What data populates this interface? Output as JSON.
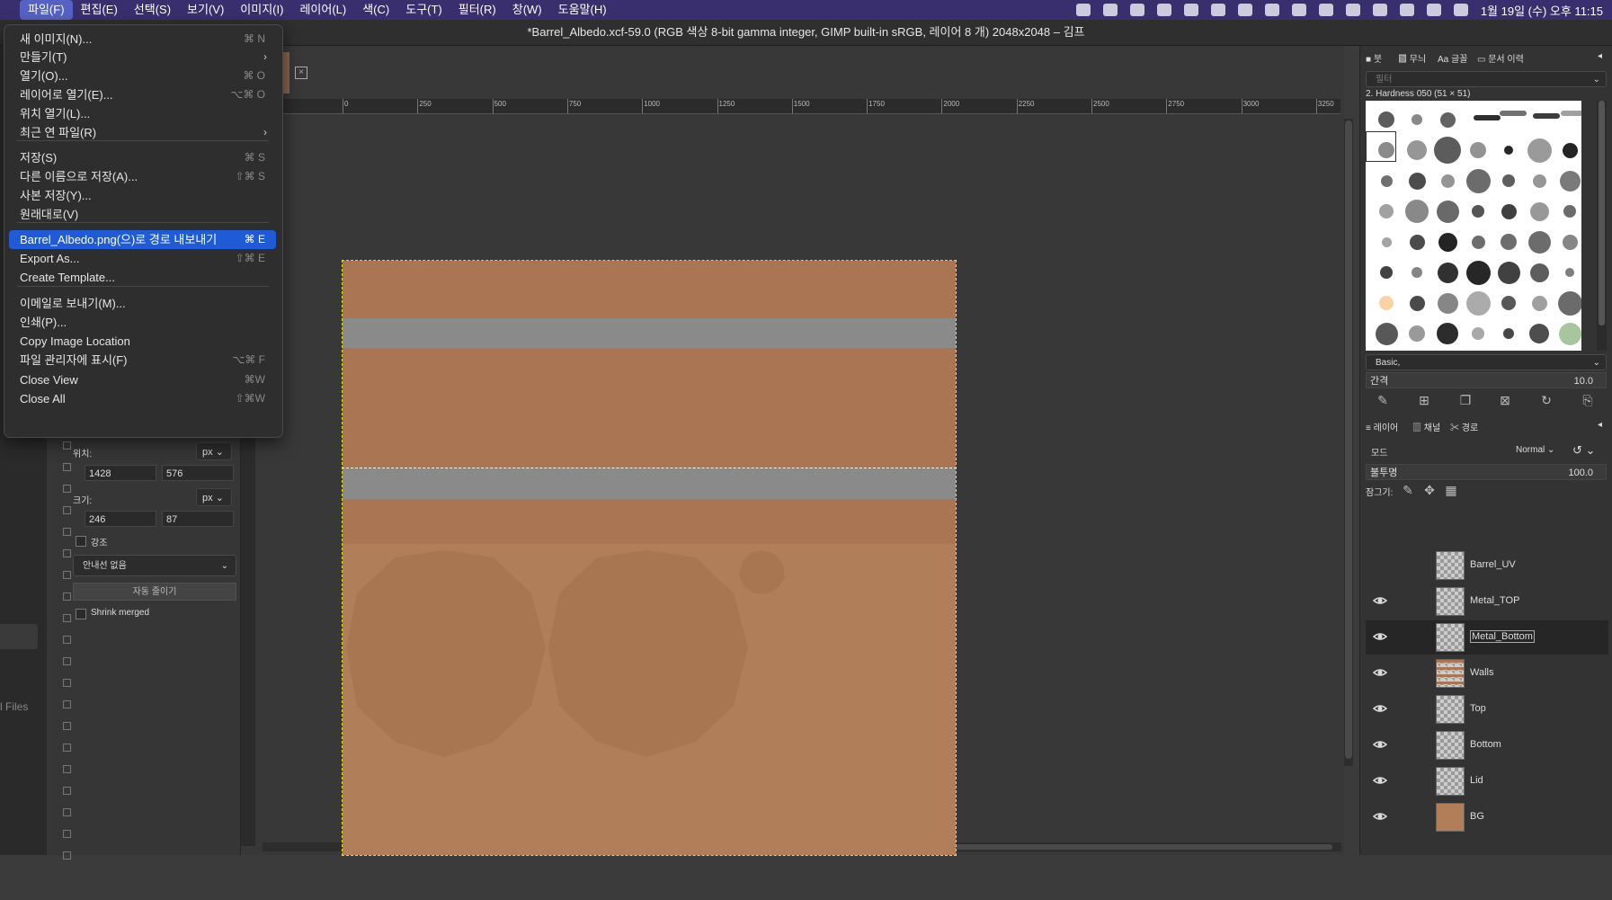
{
  "menubar": {
    "items": [
      "파일(F)",
      "편집(E)",
      "선택(S)",
      "보기(V)",
      "이미지(I)",
      "레이어(L)",
      "색(C)",
      "도구(T)",
      "필터(R)",
      "창(W)",
      "도움말(H)"
    ],
    "clock": "1월 19일 (수) 오후 11:15"
  },
  "window": {
    "title": "*Barrel_Albedo.xcf-59.0 (RGB 색상 8-bit gamma integer, GIMP built-in sRGB, 레이어 8 개) 2048x2048 – 김프"
  },
  "file_menu": {
    "items": [
      {
        "label": "새 이미지(N)...",
        "shortcut": "⌘ N"
      },
      {
        "label": "만들기(T)",
        "submenu": true
      },
      {
        "label": "열기(O)...",
        "shortcut": "⌘ O"
      },
      {
        "label": "레이어로 열기(E)...",
        "shortcut": "⌥⌘ O"
      },
      {
        "label": "위치 열기(L)...",
        "shortcut": ""
      },
      {
        "label": "최근 연 파일(R)",
        "submenu": true
      },
      {
        "label": "저장(S)",
        "shortcut": "⌘ S"
      },
      {
        "label": "다른 이름으로 저장(A)...",
        "shortcut": "⇧⌘ S"
      },
      {
        "label": "사본 저장(Y)...",
        "shortcut": ""
      },
      {
        "label": "원래대로(V)",
        "shortcut": ""
      },
      {
        "label": "Barrel_Albedo.png(으)로 경로 내보내기",
        "shortcut": "⌘ E",
        "highlighted": true
      },
      {
        "label": "Export As...",
        "shortcut": "⇧⌘ E"
      },
      {
        "label": "Create Template...",
        "shortcut": ""
      },
      {
        "label": "이메일로 보내기(M)...",
        "shortcut": ""
      },
      {
        "label": "인쇄(P)...",
        "shortcut": ""
      },
      {
        "label": "Copy Image Location",
        "shortcut": ""
      },
      {
        "label": "파일 관리자에 표시(F)",
        "shortcut": "⌥⌘ F"
      },
      {
        "label": "Close View",
        "shortcut": "⌘W"
      },
      {
        "label": "Close All",
        "shortcut": "⇧⌘W"
      }
    ]
  },
  "tool_options": {
    "position_label": "위치:",
    "size_label": "크기:",
    "unit": "px",
    "pos_x": "1428",
    "pos_y": "576",
    "size_w": "246",
    "size_h": "87",
    "highlight_label": "강조",
    "guides": "안내선 없음",
    "auto_shrink": "자동 줄이기",
    "shrink_merged": "Shrink merged"
  },
  "left_strip": {
    "files_label": "l Files"
  },
  "ruler": {
    "ticks": [
      "0",
      "250",
      "500",
      "750",
      "1000",
      "1250",
      "1500",
      "1750",
      "2000",
      "2250",
      "2500",
      "2750",
      "3000",
      "3250"
    ]
  },
  "brushes": {
    "tabs": [
      "붓",
      "무늬",
      "글꼴",
      "문서 이력"
    ],
    "filter_placeholder": "필터",
    "current": "2. Hardness 050 (51 × 51)",
    "preset": "Basic,",
    "spacing_label": "간격",
    "spacing_value": "10.0"
  },
  "layers": {
    "tabs": [
      "레이어",
      "채널",
      "경로"
    ],
    "mode_label": "모드",
    "mode_value": "Normal",
    "opacity_label": "불투명",
    "opacity_value": "100.0",
    "lock_label": "잠그기:",
    "items": [
      {
        "name": "Barrel_UV",
        "visible": false,
        "thumb": "checker"
      },
      {
        "name": "Metal_TOP",
        "visible": true,
        "thumb": "checker"
      },
      {
        "name": "Metal_Bottom",
        "visible": true,
        "thumb": "checker",
        "selected": true
      },
      {
        "name": "Walls",
        "visible": true,
        "thumb": "walls"
      },
      {
        "name": "Top",
        "visible": true,
        "thumb": "checker-dot"
      },
      {
        "name": "Bottom",
        "visible": true,
        "thumb": "checker-dot"
      },
      {
        "name": "Lid",
        "visible": true,
        "thumb": "checker"
      },
      {
        "name": "BG",
        "visible": true,
        "thumb": "solid"
      }
    ]
  },
  "colors": {
    "menubar_bg": "#3a2f6e",
    "highlight": "#1f5bd6",
    "wall": "#aa7553",
    "metal": "#8a8a8a",
    "bg": "#b07f59"
  }
}
